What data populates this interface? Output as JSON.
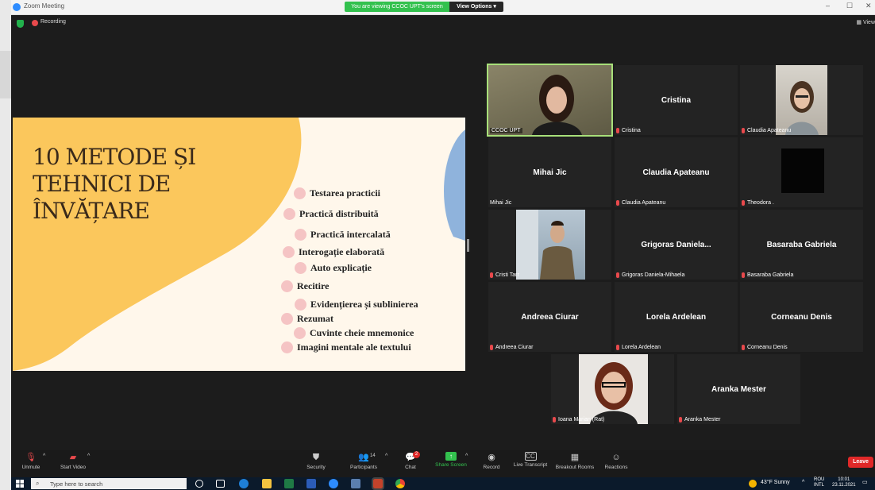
{
  "window": {
    "title": "Zoom Meeting",
    "controls": [
      "–",
      "☐",
      "✕"
    ]
  },
  "share_banner": {
    "status": "You are viewing CCOC UPT's screen",
    "view_options": "View Options ▾"
  },
  "meeting": {
    "recording_label": "Recording",
    "view_label": "View"
  },
  "slide": {
    "title": "10 METODE ȘI TEHNICI DE ÎNVĂȚARE",
    "items": [
      "Testarea practicii",
      "Practică distribuită",
      "Practică intercalată",
      "Interogație elaborată",
      "Auto explicație",
      "Recitire",
      "Evidențierea și sublinierea",
      "Rezumat",
      "Cuvinte cheie mnemonice",
      "Imagini mentale ale textului"
    ]
  },
  "participants": [
    {
      "display": "",
      "label": "CCOC UPT",
      "has_video": true,
      "muted": false
    },
    {
      "display": "Cristina",
      "label": "Cristina",
      "has_video": false,
      "muted": true
    },
    {
      "display": "",
      "label": "Claudia Apateanu",
      "has_video": true,
      "muted": true
    },
    {
      "display": "Mihai Jic",
      "label": "Mihai Jic",
      "has_video": false,
      "muted": false
    },
    {
      "display": "Claudia Apateanu",
      "label": "Claudia Apateanu",
      "has_video": false,
      "muted": true
    },
    {
      "display": "",
      "label": "Theodora .",
      "has_video": true,
      "muted": true
    },
    {
      "display": "",
      "label": "Cristi Tarr",
      "has_video": true,
      "muted": true
    },
    {
      "display": "Grigoras Daniela...",
      "label": "Grigoras Daniela-Mihaela",
      "has_video": false,
      "muted": true
    },
    {
      "display": "Basaraba Gabriela",
      "label": "Basaraba Gabriela",
      "has_video": false,
      "muted": true
    },
    {
      "display": "Andreea Ciurar",
      "label": "Andreea Ciurar",
      "has_video": false,
      "muted": true
    },
    {
      "display": "Lorela Ardelean",
      "label": "Lorela Ardelean",
      "has_video": false,
      "muted": true
    },
    {
      "display": "Corneanu Denis",
      "label": "Corneanu Denis",
      "has_video": false,
      "muted": true
    },
    {
      "display": "",
      "label": "Ioana Marian (Rat)",
      "has_video": true,
      "muted": true
    },
    {
      "display": "Aranka Mester",
      "label": "Aranka Mester",
      "has_video": false,
      "muted": true
    }
  ],
  "toolbar": {
    "unmute": "Unmute",
    "start_video": "Start Video",
    "security": "Security",
    "participants": "Participants",
    "participants_count": "14",
    "chat": "Chat",
    "chat_badge": "2",
    "share_screen": "Share Screen",
    "record": "Record",
    "live_transcript": "Live Transcript",
    "breakout_rooms": "Breakout Rooms",
    "reactions": "Reactions",
    "leave": "Leave"
  },
  "taskbar": {
    "search_placeholder": "Type here to search",
    "weather": "43°F  Sunny",
    "lang_top": "ROU",
    "lang_bottom": "INTL",
    "time": "10:01",
    "date": "23.11.2021"
  },
  "colors": {
    "zoom_blue": "#2d8cff",
    "share_green": "#33c14e",
    "leave_red": "#e02828",
    "active_speaker": "#a8e07a",
    "slide_bg": "#fff7eb",
    "slide_blob": "#fbc75c",
    "slide_corner": "#8fb3dc",
    "bullet": "#f5c4c4"
  }
}
